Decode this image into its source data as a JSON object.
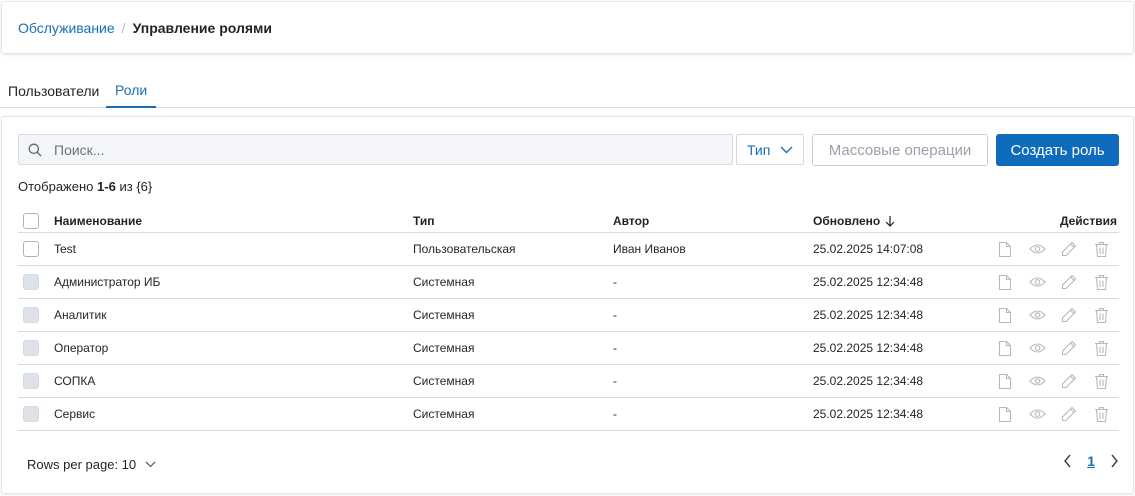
{
  "breadcrumb": {
    "parent": "Обслуживание",
    "separator": "/",
    "current": "Управление ролями"
  },
  "tabs": [
    {
      "label": "Пользователи",
      "active": false
    },
    {
      "label": "Роли",
      "active": true
    }
  ],
  "toolbar": {
    "search_placeholder": "Поиск...",
    "type_filter": "Тип",
    "mass_ops_label": "Массовые операции",
    "create_label": "Создать роль"
  },
  "count": {
    "prefix": "Отображено",
    "range": "1-6",
    "middle": "из",
    "total": "{6}"
  },
  "table": {
    "columns": {
      "name": "Наименование",
      "type": "Тип",
      "author": "Автор",
      "updated": "Обновлено",
      "actions": "Действия"
    },
    "rows": [
      {
        "name": "Test",
        "type": "Пользовательская",
        "author": "Иван Иванов",
        "updated": "25.02.2025 14:07:08"
      },
      {
        "name": "Администратор ИБ",
        "type": "Системная",
        "author": "-",
        "updated": "25.02.2025 12:34:48"
      },
      {
        "name": "Аналитик",
        "type": "Системная",
        "author": "-",
        "updated": "25.02.2025 12:34:48"
      },
      {
        "name": "Оператор",
        "type": "Системная",
        "author": "-",
        "updated": "25.02.2025 12:34:48"
      },
      {
        "name": "СОПКА",
        "type": "Системная",
        "author": "-",
        "updated": "25.02.2025 12:34:48"
      },
      {
        "name": "Сервис",
        "type": "Системная",
        "author": "-",
        "updated": "25.02.2025 12:34:48"
      }
    ]
  },
  "footer": {
    "rows_per_page": "Rows per page: 10",
    "current_page": "1"
  },
  "colors": {
    "accent": "#0f6cbd",
    "link": "#1a6fb3",
    "border": "#d8dce1"
  }
}
